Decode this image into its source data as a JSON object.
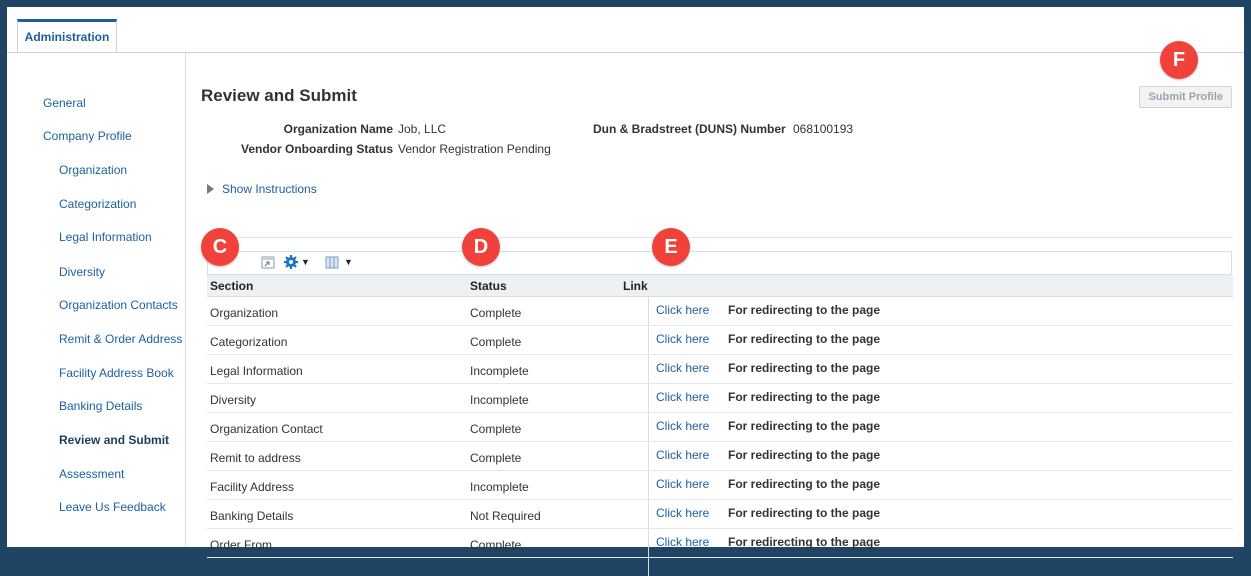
{
  "tabs": {
    "active": "Administration"
  },
  "sidebar": {
    "items": [
      {
        "label": "General"
      },
      {
        "label": "Company Profile"
      },
      {
        "label": "Organization"
      },
      {
        "label": "Categorization"
      },
      {
        "label": "Legal Information"
      },
      {
        "label": "Diversity"
      },
      {
        "label": "Organization Contacts"
      },
      {
        "label": "Remit & Order Address"
      },
      {
        "label": "Facility Address Book"
      },
      {
        "label": "Banking Details"
      },
      {
        "label": "Review and Submit"
      },
      {
        "label": "Assessment"
      },
      {
        "label": "Leave Us Feedback"
      }
    ]
  },
  "page": {
    "title": "Review and Submit",
    "submit_label": "Submit Profile",
    "org_name_label": "Organization Name",
    "org_name_value": "Job, LLC",
    "status_label": "Vendor Onboarding Status",
    "status_value": "Vendor Registration Pending",
    "duns_label": "Dun & Bradstreet (DUNS) Number",
    "duns_value": "068100193",
    "show_instructions": "Show Instructions"
  },
  "toolbar": {
    "icons": [
      "detach-icon",
      "gear-icon",
      "columns-icon"
    ]
  },
  "table": {
    "headers": [
      "Section",
      "Status",
      "Link"
    ],
    "rows": [
      {
        "section": "Organization",
        "status": "Complete",
        "link": "Click here",
        "note": "For redirecting to the page"
      },
      {
        "section": "Categorization",
        "status": "Complete",
        "link": "Click here",
        "note": "For redirecting to the page"
      },
      {
        "section": "Legal Information",
        "status": "Incomplete",
        "link": "Click here",
        "note": "For redirecting to the page"
      },
      {
        "section": "Diversity",
        "status": "Incomplete",
        "link": "Click here",
        "note": "For redirecting to the page"
      },
      {
        "section": "Organization Contact",
        "status": "Complete",
        "link": "Click here",
        "note": "For redirecting to the page"
      },
      {
        "section": "Remit to address",
        "status": "Complete",
        "link": "Click here",
        "note": "For redirecting to the page"
      },
      {
        "section": "Facility Address",
        "status": "Incomplete",
        "link": "Click here",
        "note": "For redirecting to the page"
      },
      {
        "section": "Banking Details",
        "status": "Not Required",
        "link": "Click here",
        "note": "For redirecting to the page"
      },
      {
        "section": "Order From",
        "status": "Complete",
        "link": "Click here",
        "note": "For redirecting to the page"
      }
    ]
  },
  "callouts": {
    "c": "C",
    "d": "D",
    "e": "E",
    "f": "F"
  },
  "colors": {
    "accent": "#1c5f9e",
    "callout": "#f0413a",
    "frame": "#1f4464"
  }
}
